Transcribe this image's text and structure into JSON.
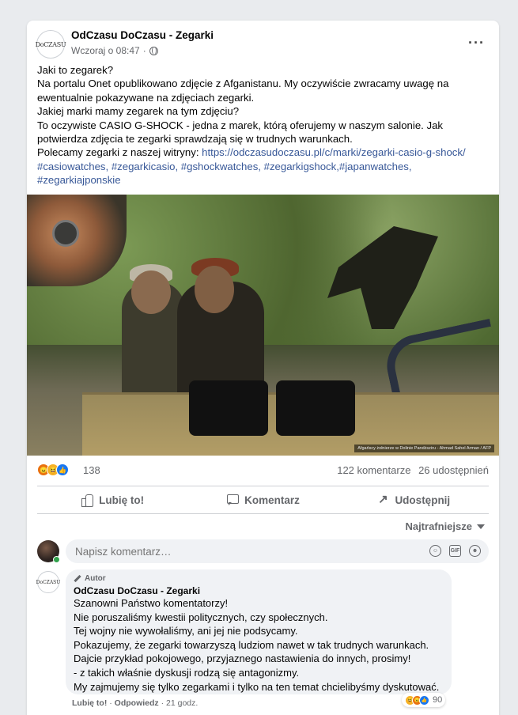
{
  "post": {
    "page_name": "OdCzasu DoCzasu - Zegarki",
    "logo_text": "DoCZASU",
    "time": "Wczoraj o 08:47",
    "separator": "·",
    "more": "···",
    "text_lines": [
      "Jaki to zegarek?",
      "Na portalu Onet opublikowano zdjęcie z Afganistanu. My oczywiście zwracamy uwagę na",
      "ewentualnie pokazywane na zdjęciach zegarki.",
      "Jakiej marki mamy zegarek na tym zdjęciu?",
      "To oczywiste CASIO G-SHOCK - jedna z marek, którą oferujemy w naszym salonie. Jak",
      "potwierdza zdjęcia te zegarki sprawdzają się w trudnych warunkach."
    ],
    "recommend_text": "Polecamy zegarki z naszej witryny: ",
    "link": "https://odczasudoczasu.pl/c/marki/zegarki-casio-g-shock/",
    "hashtags_line1": "#casiowatches, #zegarkicasio, #gshockwatches, #zegarkigshock,#japanwatches,",
    "hashtags_line2": "#zegarkiajponskie",
    "photo_credit": "Afgańscy żołnierze w Dolinie Pandższiru - Ahmad Sahel Arman / AFP"
  },
  "stats": {
    "reactions_count": "138",
    "comments": "122 komentarze",
    "shares": "26 udostępnień"
  },
  "actions": {
    "like": "Lubię to!",
    "comment": "Komentarz",
    "share": "Udostępnij"
  },
  "sort_label": "Najtrafniejsze",
  "comment_input": {
    "placeholder": "Napisz komentarz…"
  },
  "comment": {
    "author_badge": "Autor",
    "name": "OdCzasu DoCzasu - Zegarki",
    "lines": [
      "Szanowni Państwo komentatorzy!",
      "Nie poruszaliśmy kwestii politycznych, czy społecznych.",
      "Tej wojny nie wywołaliśmy, ani jej nie podsycamy.",
      "Pokazujemy, że zegarki towarzyszą ludziom nawet w tak trudnych warunkach.",
      "Dajcie przykład pokojowego, przyjaznego nastawienia do innych, prosimy!",
      "- z takich właśnie dyskusji rodzą się antagonizmy.",
      "My zajmujemy się tylko zegarkami i tylko na ten temat chcielibyśmy dyskutować."
    ],
    "reactions_count": "90",
    "like": "Lubię to!",
    "reply": "Odpowiedz",
    "dot": "·",
    "time": "21 godz."
  },
  "icons": {
    "reaction_angry": "angry-icon",
    "reaction_haha": "haha-icon",
    "reaction_like": "like-icon"
  },
  "colors": {
    "link": "#385898",
    "like_blue": "#1877f2",
    "online": "#31a24c"
  }
}
